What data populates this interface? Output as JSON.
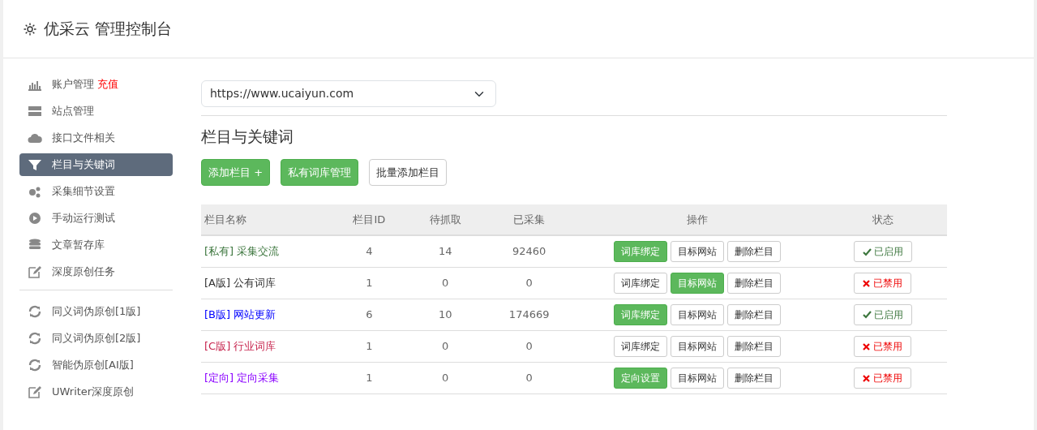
{
  "header": {
    "title": "优采云 管理控制台"
  },
  "sidebar": {
    "items": [
      {
        "label": "账户管理",
        "link": "充值",
        "selected": false
      },
      {
        "label": "站点管理",
        "selected": false
      },
      {
        "label": "接口文件相关",
        "selected": false
      },
      {
        "label": "栏目与关键词",
        "selected": true
      },
      {
        "label": "采集细节设置",
        "selected": false
      },
      {
        "label": "手动运行测试",
        "selected": false
      },
      {
        "label": "文章暂存库",
        "selected": false
      },
      {
        "label": "深度原创任务",
        "selected": false
      },
      {
        "label": "同义词伪原创[1版]",
        "selected": false
      },
      {
        "label": "同义词伪原创[2版]",
        "selected": false
      },
      {
        "label": "智能伪原创[AI版]",
        "selected": false
      },
      {
        "label": "UWriter深度原创",
        "selected": false
      }
    ]
  },
  "site_select": {
    "value": "https://www.ucaiyun.com"
  },
  "section_title": "栏目与关键词",
  "actions": [
    {
      "label": "添加栏目 +",
      "primary": true
    },
    {
      "label": "私有词库管理",
      "primary": true
    },
    {
      "label": "批量添加栏目",
      "primary": false
    }
  ],
  "table": {
    "columns": [
      "栏目名称",
      "栏目ID",
      "待抓取",
      "已采集",
      "操作",
      "状态"
    ],
    "rows": [
      {
        "color": "#3c763d",
        "cells": [
          "[私有] 采集交流",
          "4",
          "14",
          "92460"
        ],
        "ops": [
          {
            "label": "词库绑定",
            "primary": true
          },
          {
            "label": "目标网站",
            "primary": false
          },
          {
            "label": "删除栏目",
            "primary": false
          }
        ],
        "status": "已启用",
        "enabled": true
      },
      {
        "color": "#333333",
        "cells": [
          "[A版] 公有词库",
          "1",
          "0",
          "0"
        ],
        "ops": [
          {
            "label": "词库绑定",
            "primary": false
          },
          {
            "label": "目标网站",
            "primary": true
          },
          {
            "label": "删除栏目",
            "primary": false
          }
        ],
        "status": "已禁用",
        "enabled": false
      },
      {
        "color": "#0000ff",
        "cells": [
          "[B版] 网站更新",
          "6",
          "10",
          "174669"
        ],
        "ops": [
          {
            "label": "词库绑定",
            "primary": true
          },
          {
            "label": "目标网站",
            "primary": false
          },
          {
            "label": "删除栏目",
            "primary": false
          }
        ],
        "status": "已启用",
        "enabled": true
      },
      {
        "color": "#c7254e",
        "cells": [
          "[C版] 行业词库",
          "1",
          "0",
          "0"
        ],
        "ops": [
          {
            "label": "词库绑定",
            "primary": false
          },
          {
            "label": "目标网站",
            "primary": false
          },
          {
            "label": "删除栏目",
            "primary": false
          }
        ],
        "status": "已禁用",
        "enabled": false
      },
      {
        "color": "#8a00ff",
        "cells": [
          "[定向] 定向采集",
          "1",
          "0",
          "0"
        ],
        "ops": [
          {
            "label": "定向设置",
            "primary": true
          },
          {
            "label": "目标网站",
            "primary": false
          },
          {
            "label": "删除栏目",
            "primary": false
          }
        ],
        "status": "已禁用",
        "enabled": false
      }
    ]
  }
}
